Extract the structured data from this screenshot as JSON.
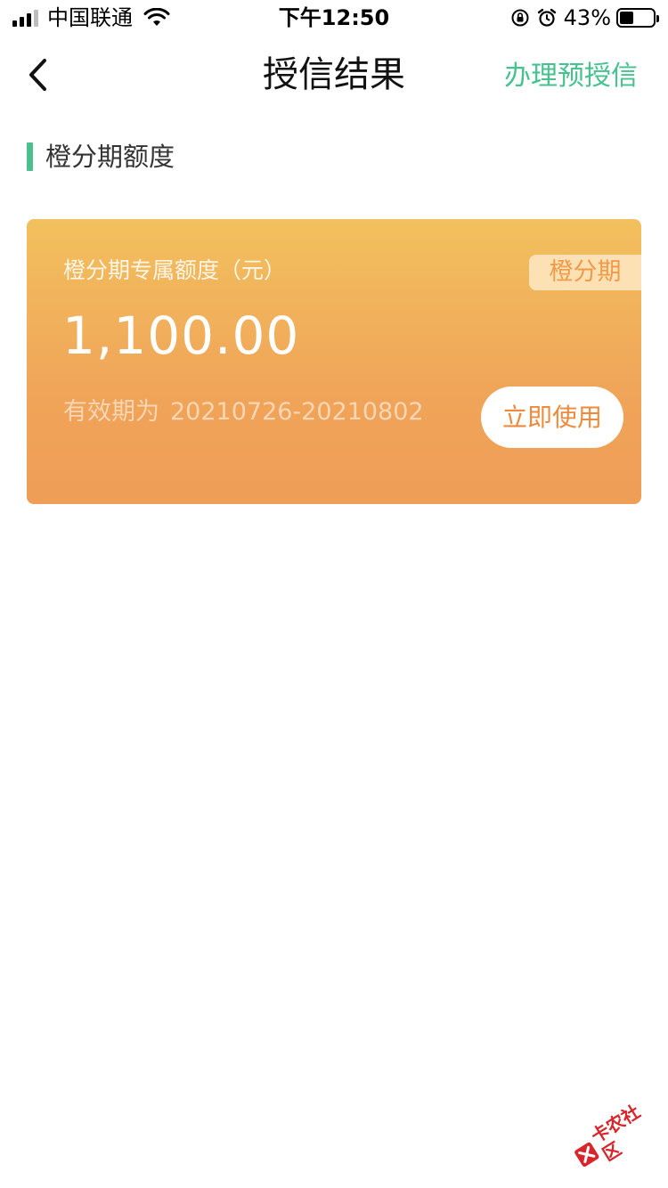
{
  "status_bar": {
    "carrier": "中国联通",
    "time": "下午12:50",
    "battery_percent": "43%",
    "battery_level": 0.43
  },
  "nav": {
    "title": "授信结果",
    "action_label": "办理预授信"
  },
  "section": {
    "title": "橙分期额度"
  },
  "card": {
    "label": "橙分期专属额度（元）",
    "tag": "橙分期",
    "amount": "1,100.00",
    "validity_label": "有效期为",
    "validity_range": "20210726-20210802",
    "button_label": "立即使用"
  },
  "watermark": {
    "text": "卡农社区"
  },
  "colors": {
    "accent_green": "#46c28e",
    "card_gradient_top": "#f2c05e",
    "card_gradient_bottom": "#ef9d57",
    "button_text": "#ef8a3c"
  }
}
